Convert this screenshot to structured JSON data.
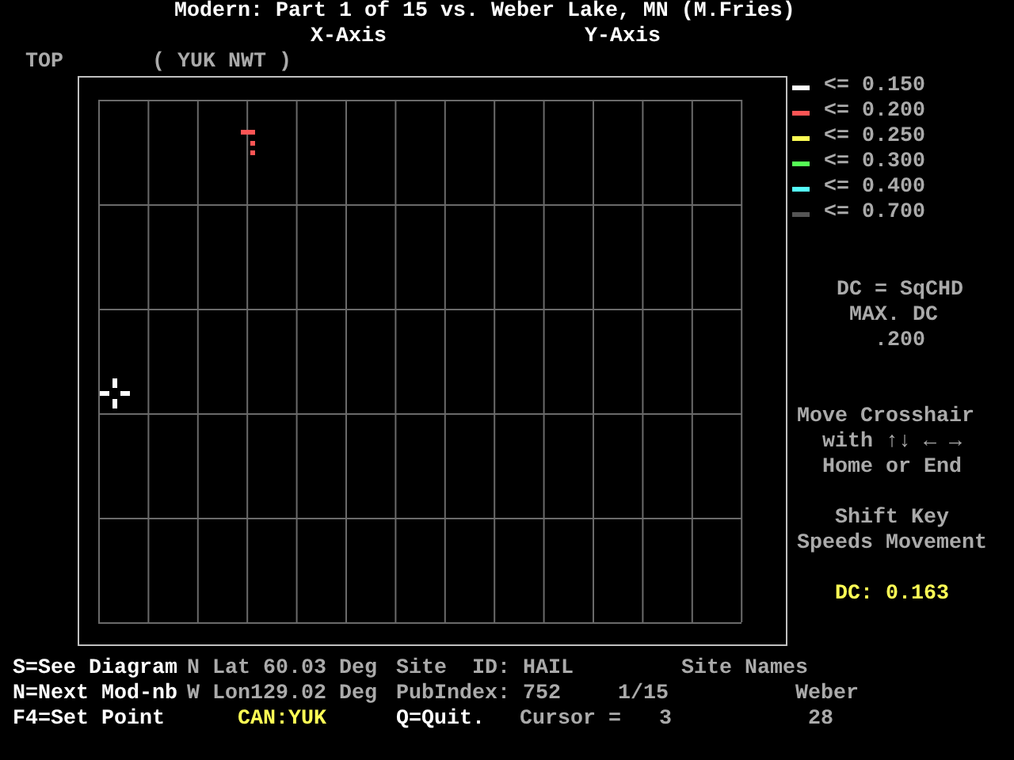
{
  "title": "Modern: Part 1 of 15 vs. Weber Lake, MN (M.Fries)",
  "axes": {
    "x": "X-Axis",
    "y": "Y-Axis"
  },
  "view": {
    "label": "TOP",
    "region": "( YUK NWT )"
  },
  "legend": [
    {
      "label": "<= 0.150",
      "color": "#ffffff"
    },
    {
      "label": "<= 0.200",
      "color": "#ff5555"
    },
    {
      "label": "<= 0.250",
      "color": "#ffff55"
    },
    {
      "label": "<= 0.300",
      "color": "#55ff55"
    },
    {
      "label": "<= 0.400",
      "color": "#55ffff"
    },
    {
      "label": "<= 0.700",
      "color": "#555555"
    }
  ],
  "measure": [
    "DC = SqCHD",
    "MAX. DC",
    ".200"
  ],
  "help": [
    "Move Crosshair",
    "with ↑↓ ← →",
    "Home or End",
    "Shift Key",
    "Speeds Movement"
  ],
  "dc_value": "DC: 0.163",
  "status_rows": [
    [
      {
        "text": "S=See Diagram",
        "kind": "command"
      },
      {
        "text": "N Lat 60.03 Deg",
        "kind": "info"
      },
      {
        "text": "Site  ID: HAIL",
        "kind": "info"
      },
      {
        "text": "Site Names",
        "kind": "info"
      }
    ],
    [
      {
        "text": "N=Next Mod-nb",
        "kind": "command"
      },
      {
        "text": "W Lon129.02 Deg",
        "kind": "info"
      },
      {
        "text": "PubIndex: 752",
        "kind": "info"
      },
      {
        "text": "1/15",
        "kind": "info"
      },
      {
        "text": "Weber",
        "kind": "info"
      }
    ],
    [
      {
        "text": "F4=Set Point",
        "kind": "command"
      },
      {
        "text": "CAN:YUK",
        "kind": "highlight"
      },
      {
        "text": "Q=Quit.",
        "kind": "command"
      },
      {
        "text": "Cursor =   3",
        "kind": "info"
      },
      {
        "text": "28",
        "kind": "info"
      }
    ]
  ]
}
